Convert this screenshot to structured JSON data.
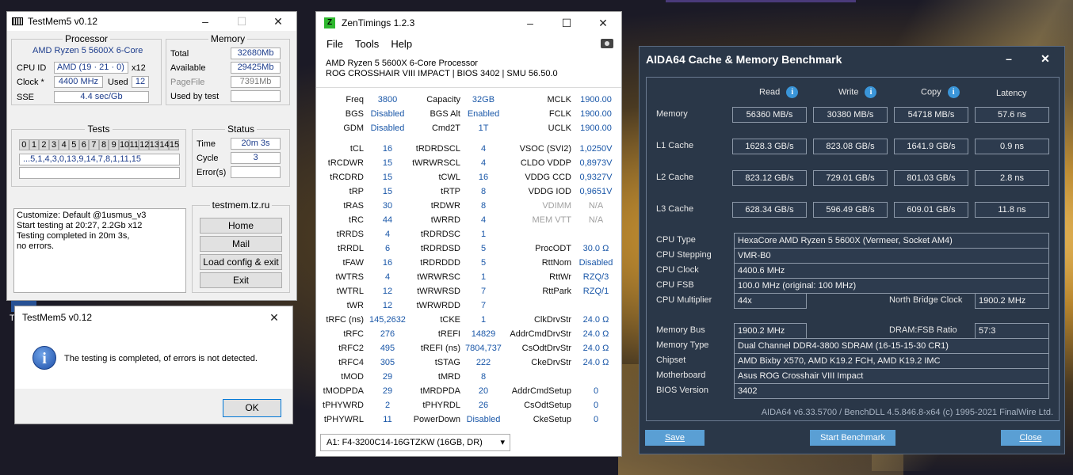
{
  "testmem": {
    "title": "TestMem5 v0.12",
    "processor": {
      "heading": "Processor",
      "name": "AMD Ryzen 5 5600X 6-Core",
      "cpuid_label": "CPU ID",
      "cpuid_value": "AMD  (19 · 21 · 0)",
      "cpuid_mult": "x12",
      "clock_label": "Clock *",
      "clock_value": "4400 MHz",
      "used_label": "Used",
      "used_value": "12",
      "sse_label": "SSE",
      "sse_value": "4.4 sec/Gb"
    },
    "memory": {
      "heading": "Memory",
      "total_label": "Total",
      "total_value": "32680Mb",
      "available_label": "Available",
      "available_value": "29425Mb",
      "pagefile_label": "PageFile",
      "pagefile_value": "7391Mb",
      "usedbytest_label": "Used by test",
      "usedbytest_value": ""
    },
    "tests": {
      "heading": "Tests",
      "cells": [
        "0",
        "1",
        "2",
        "3",
        "4",
        "5",
        "6",
        "7",
        "8",
        "9",
        "10",
        "11",
        "12",
        "13",
        "14",
        "15"
      ],
      "sequence": "...5,1,4,3,0,13,9,14,7,8,1,11,15"
    },
    "status": {
      "heading": "Status",
      "time_label": "Time",
      "time_value": "20m 3s",
      "cycle_label": "Cycle",
      "cycle_value": "3",
      "errors_label": "Error(s)",
      "errors_value": ""
    },
    "log": "Customize: Default @1usmus_v3\nStart testing at 20:27, 2.2Gb x12\nTesting completed in 20m 3s,\nno errors.",
    "site": "testmem.tz.ru",
    "buttons": {
      "home": "Home",
      "mail": "Mail",
      "load": "Load config & exit",
      "exit": "Exit"
    }
  },
  "dialog": {
    "title": "TestMem5 v0.12",
    "message": "The testing is completed, of errors is not detected.",
    "ok": "OK"
  },
  "desktop_fragment": "T",
  "zentimings": {
    "title": "ZenTimings 1.2.3",
    "menu": [
      "File",
      "Tools",
      "Help"
    ],
    "cpu": "AMD Ryzen 5 5600X 6-Core Processor",
    "board": "ROG CROSSHAIR VIII IMPACT | BIOS 3402 | SMU 56.50.0",
    "rows": [
      [
        [
          "Freq",
          "3800"
        ],
        [
          "Capacity",
          "32GB"
        ],
        [
          "MCLK",
          "1900.00"
        ]
      ],
      [
        [
          "BGS",
          "Disabled"
        ],
        [
          "BGS Alt",
          "Enabled"
        ],
        [
          "FCLK",
          "1900.00"
        ]
      ],
      [
        [
          "GDM",
          "Disabled"
        ],
        [
          "Cmd2T",
          "1T"
        ],
        [
          "UCLK",
          "1900.00"
        ]
      ],
      [
        [
          "tCL",
          "16"
        ],
        [
          "tRDRDSCL",
          "4"
        ],
        [
          "VSOC (SVI2)",
          "1,0250V"
        ]
      ],
      [
        [
          "tRCDWR",
          "15"
        ],
        [
          "tWRWRSCL",
          "4"
        ],
        [
          "CLDO VDDP",
          "0,8973V"
        ]
      ],
      [
        [
          "tRCDRD",
          "15"
        ],
        [
          "tCWL",
          "16"
        ],
        [
          "VDDG CCD",
          "0,9327V"
        ]
      ],
      [
        [
          "tRP",
          "15"
        ],
        [
          "tRTP",
          "8"
        ],
        [
          "VDDG IOD",
          "0,9651V"
        ]
      ],
      [
        [
          "tRAS",
          "30"
        ],
        [
          "tRDWR",
          "8"
        ],
        [
          "VDIMM",
          "N/A"
        ]
      ],
      [
        [
          "tRC",
          "44"
        ],
        [
          "tWRRD",
          "4"
        ],
        [
          "MEM VTT",
          "N/A"
        ]
      ],
      [
        [
          "tRRDS",
          "4"
        ],
        [
          "tRDRDSC",
          "1"
        ],
        [
          "",
          ""
        ]
      ],
      [
        [
          "tRRDL",
          "6"
        ],
        [
          "tRDRDSD",
          "5"
        ],
        [
          "ProcODT",
          "30.0 Ω"
        ]
      ],
      [
        [
          "tFAW",
          "16"
        ],
        [
          "tRDRDDD",
          "5"
        ],
        [
          "RttNom",
          "Disabled"
        ]
      ],
      [
        [
          "tWTRS",
          "4"
        ],
        [
          "tWRWRSC",
          "1"
        ],
        [
          "RttWr",
          "RZQ/3"
        ]
      ],
      [
        [
          "tWTRL",
          "12"
        ],
        [
          "tWRWRSD",
          "7"
        ],
        [
          "RttPark",
          "RZQ/1"
        ]
      ],
      [
        [
          "tWR",
          "12"
        ],
        [
          "tWRWRDD",
          "7"
        ],
        [
          "",
          ""
        ]
      ],
      [
        [
          "tRFC (ns)",
          "145,2632"
        ],
        [
          "tCKE",
          "1"
        ],
        [
          "ClkDrvStr",
          "24.0 Ω"
        ]
      ],
      [
        [
          "tRFC",
          "276"
        ],
        [
          "tREFI",
          "14829"
        ],
        [
          "AddrCmdDrvStr",
          "24.0 Ω"
        ]
      ],
      [
        [
          "tRFC2",
          "495"
        ],
        [
          "tREFI (ns)",
          "7804,737"
        ],
        [
          "CsOdtDrvStr",
          "24.0 Ω"
        ]
      ],
      [
        [
          "tRFC4",
          "305"
        ],
        [
          "tSTAG",
          "222"
        ],
        [
          "CkeDrvStr",
          "24.0 Ω"
        ]
      ],
      [
        [
          "tMOD",
          "29"
        ],
        [
          "tMRD",
          "8"
        ],
        [
          "",
          ""
        ]
      ],
      [
        [
          "tMODPDA",
          "29"
        ],
        [
          "tMRDPDA",
          "20"
        ],
        [
          "AddrCmdSetup",
          "0"
        ]
      ],
      [
        [
          "tPHYWRD",
          "2"
        ],
        [
          "tPHYRDL",
          "26"
        ],
        [
          "CsOdtSetup",
          "0"
        ]
      ],
      [
        [
          "tPHYWRL",
          "11"
        ],
        [
          "PowerDown",
          "Disabled"
        ],
        [
          "CkeSetup",
          "0"
        ]
      ]
    ],
    "module": "A1: F4-3200C14-16GTZKW (16GB, DR)"
  },
  "aida": {
    "title": "AIDA64 Cache & Memory Benchmark",
    "headers": [
      "Read",
      "Write",
      "Copy",
      "Latency"
    ],
    "bench": [
      {
        "label": "Memory",
        "read": "56360 MB/s",
        "write": "30380 MB/s",
        "copy": "54718 MB/s",
        "latency": "57.6 ns"
      },
      {
        "label": "L1 Cache",
        "read": "1628.3 GB/s",
        "write": "823.08 GB/s",
        "copy": "1641.9 GB/s",
        "latency": "0.9 ns"
      },
      {
        "label": "L2 Cache",
        "read": "823.12 GB/s",
        "write": "729.01 GB/s",
        "copy": "801.03 GB/s",
        "latency": "2.8 ns"
      },
      {
        "label": "L3 Cache",
        "read": "628.34 GB/s",
        "write": "596.49 GB/s",
        "copy": "609.01 GB/s",
        "latency": "11.8 ns"
      }
    ],
    "info": {
      "cpu_type_label": "CPU Type",
      "cpu_type": "HexaCore AMD Ryzen 5 5600X  (Vermeer, Socket AM4)",
      "cpu_stepping_label": "CPU Stepping",
      "cpu_stepping": "VMR-B0",
      "cpu_clock_label": "CPU Clock",
      "cpu_clock": "4400.6 MHz",
      "cpu_fsb_label": "CPU FSB",
      "cpu_fsb": "100.0 MHz  (original: 100 MHz)",
      "cpu_mult_label": "CPU Multiplier",
      "cpu_mult": "44x",
      "nb_clock_label": "North Bridge Clock",
      "nb_clock": "1900.2 MHz",
      "mem_bus_label": "Memory Bus",
      "mem_bus": "1900.2 MHz",
      "dram_ratio_label": "DRAM:FSB Ratio",
      "dram_ratio": "57:3",
      "mem_type_label": "Memory Type",
      "mem_type": "Dual Channel DDR4-3800 SDRAM  (16-15-15-30 CR1)",
      "chipset_label": "Chipset",
      "chipset": "AMD Bixby X570, AMD K19.2 FCH, AMD K19.2 IMC",
      "mobo_label": "Motherboard",
      "mobo": "Asus ROG Crosshair VIII Impact",
      "bios_label": "BIOS Version",
      "bios": "3402"
    },
    "footer": "AIDA64 v6.33.5700 / BenchDLL 4.5.846.8-x64  (c) 1995-2021 FinalWire Ltd.",
    "buttons": {
      "save": "Save",
      "start": "Start Benchmark",
      "close": "Close"
    }
  },
  "colors": {
    "aida_bg": "#2a3748",
    "aida_button": "#5a9fd4",
    "zen_value": "#1a57a8",
    "tm_value": "#1c3c8c"
  }
}
